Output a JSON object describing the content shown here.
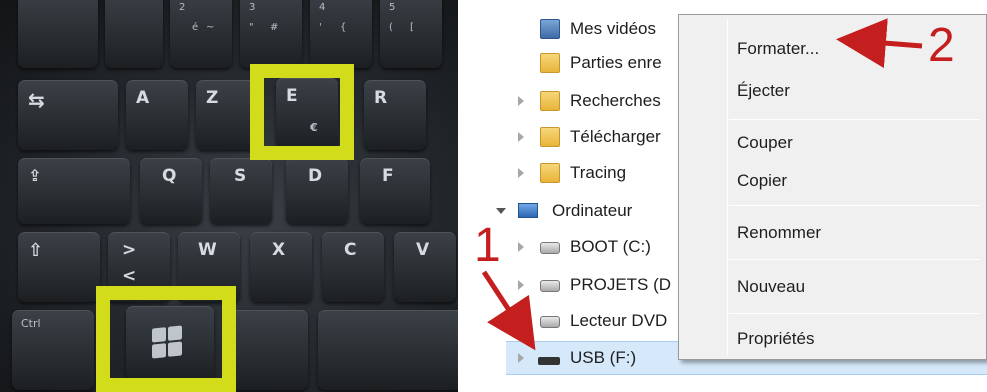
{
  "keyboard": {
    "row_numbers": [
      "2",
      "é",
      "~",
      "3",
      "\"",
      "#",
      "4",
      "'",
      "{",
      "5",
      "(",
      "["
    ],
    "keys": {
      "tab": "⇆",
      "a": "A",
      "z": "Z",
      "e": "E",
      "e_sub": "€",
      "r": "R",
      "caps": "⇪",
      "q": "Q",
      "s": "S",
      "d": "D",
      "f": "F",
      "shift": "⇧",
      "gt": ">",
      "lt": "<",
      "w": "W",
      "x": "X",
      "c": "C",
      "v": "V",
      "ctrl": "Ctrl"
    },
    "highlight_color": "#d3dc1b"
  },
  "tree": {
    "items": [
      {
        "label": "Mes vidéos",
        "icon": "videos-folder-icon"
      },
      {
        "label": "Parties enre",
        "icon": "shared-folder-icon"
      },
      {
        "label": "Recherches",
        "icon": "search-folder-icon"
      },
      {
        "label": "Télécharger",
        "icon": "downloads-folder-icon"
      },
      {
        "label": "Tracing",
        "icon": "folder-icon"
      },
      {
        "label": "Ordinateur",
        "icon": "computer-icon"
      },
      {
        "label": "BOOT (C:)",
        "icon": "system-drive-icon"
      },
      {
        "label": "PROJETS (D",
        "icon": "hard-drive-icon"
      },
      {
        "label": "Lecteur DVD",
        "icon": "dvd-drive-icon"
      },
      {
        "label": "USB (F:)",
        "icon": "usb-drive-icon"
      }
    ]
  },
  "context_menu": {
    "items": [
      "Formater...",
      "Éjecter",
      "Couper",
      "Copier",
      "Renommer",
      "Nouveau",
      "Propriétés"
    ]
  },
  "annotations": {
    "step1": "1",
    "step2": "2",
    "color": "#c41e1e"
  }
}
